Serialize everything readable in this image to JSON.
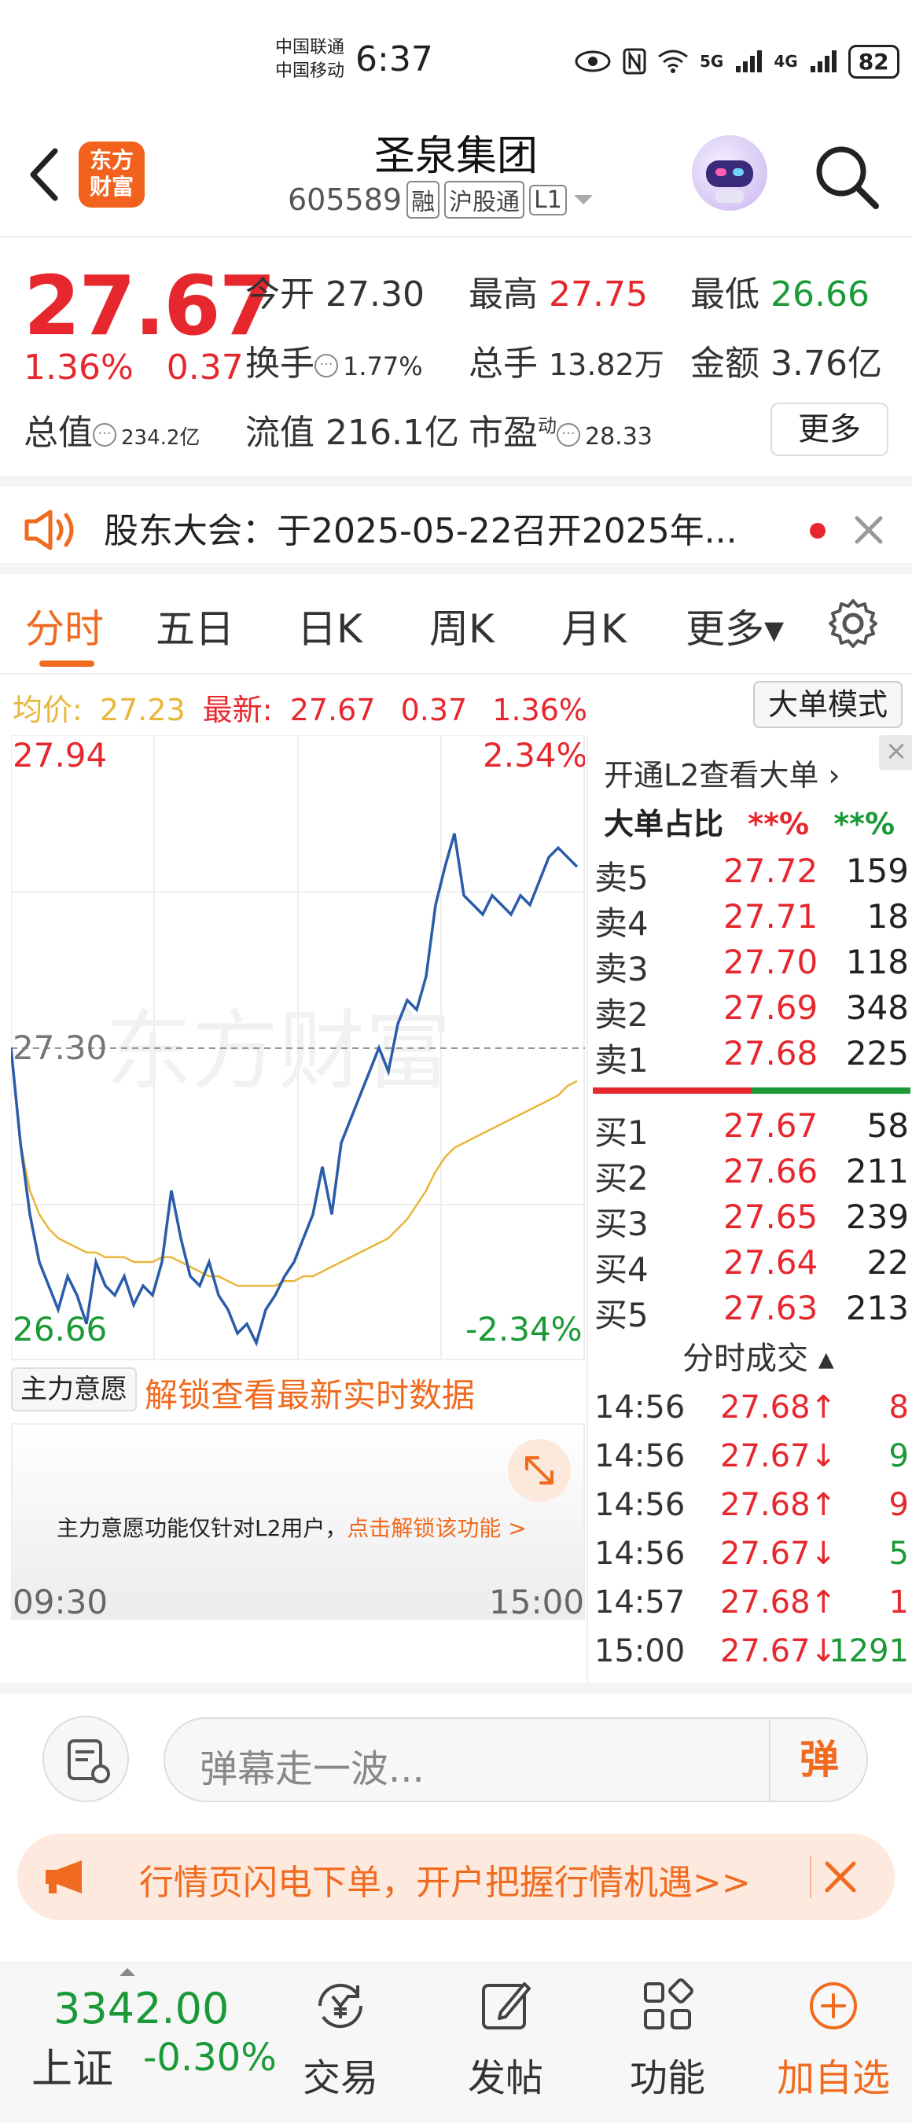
{
  "status_bar": {
    "carrier_1": "中国联通",
    "carrier_2": "中国移动",
    "time": "6:37",
    "network_1": "5G",
    "network_2": "4G",
    "battery": "82"
  },
  "header": {
    "logo_line1": "东方",
    "logo_line2": "财富",
    "stock_name": "圣泉集团",
    "stock_code": "605589",
    "tags": [
      "融",
      "沪股通",
      "L1"
    ]
  },
  "quote": {
    "price": "27.67",
    "change_pct": "1.36%",
    "change_amt": "0.37",
    "open_label": "今开",
    "open": "27.30",
    "high_label": "最高",
    "high": "27.75",
    "low_label": "最低",
    "low": "26.66",
    "turnover_label": "换手",
    "turnover": "1.77%",
    "volume_label": "总手",
    "volume": "13.82万",
    "amount_label": "金额",
    "amount": "3.76亿",
    "mktcap_label": "总值",
    "mktcap": "234.2亿",
    "float_label": "流值",
    "float_cap": "216.1亿",
    "pe_label": "市盈",
    "pe_sup": "动",
    "pe": "28.33",
    "more_button": "更多"
  },
  "notice": {
    "text": "股东大会：于2025-05-22召开2025年..."
  },
  "tabs": [
    {
      "label": "分时",
      "active": true
    },
    {
      "label": "五日"
    },
    {
      "label": "日K"
    },
    {
      "label": "周K"
    },
    {
      "label": "月K"
    },
    {
      "label": "更多▾"
    }
  ],
  "avg_row": {
    "avg_label": "均价:",
    "avg_value": "27.23",
    "latest_label": "最新:",
    "latest_value": "27.67",
    "latest_chg": "0.37",
    "latest_pct": "1.36%",
    "big_order_mode": "大单模式"
  },
  "chart_data": {
    "type": "line",
    "y_max_label": "27.94",
    "y_min_label": "26.66",
    "y_mid_label": "27.30",
    "pct_max_label": "2.34%",
    "pct_min_label": "-2.34%",
    "watermark": "东方财富",
    "x_start_label": "09:30",
    "x_end_label": "15:00",
    "ylim": [
      26.66,
      27.94
    ],
    "prev_close": 27.3,
    "series": [
      {
        "name": "price",
        "color": "#2a5caa",
        "values": [
          27.3,
          27.1,
          26.95,
          26.85,
          26.8,
          26.75,
          26.82,
          26.78,
          26.72,
          26.85,
          26.8,
          26.78,
          26.82,
          26.76,
          26.8,
          26.78,
          26.85,
          27.0,
          26.9,
          26.82,
          26.8,
          26.85,
          26.78,
          26.75,
          26.7,
          26.72,
          26.68,
          26.75,
          26.78,
          26.82,
          26.85,
          26.9,
          26.95,
          27.05,
          26.95,
          27.1,
          27.15,
          27.2,
          27.25,
          27.3,
          27.25,
          27.35,
          27.4,
          27.38,
          27.45,
          27.6,
          27.68,
          27.75,
          27.62,
          27.6,
          27.58,
          27.62,
          27.6,
          27.58,
          27.62,
          27.6,
          27.65,
          27.7,
          27.72,
          27.7,
          27.68
        ]
      },
      {
        "name": "avg",
        "color": "#e8b63a",
        "values": [
          27.3,
          27.1,
          27.0,
          26.95,
          26.92,
          26.9,
          26.89,
          26.88,
          26.87,
          26.87,
          26.86,
          26.86,
          26.86,
          26.85,
          26.85,
          26.85,
          26.86,
          26.86,
          26.85,
          26.84,
          26.83,
          26.82,
          26.82,
          26.81,
          26.8,
          26.8,
          26.8,
          26.8,
          26.8,
          26.81,
          26.81,
          26.82,
          26.82,
          26.83,
          26.84,
          26.85,
          26.86,
          26.87,
          26.88,
          26.89,
          26.9,
          26.92,
          26.94,
          26.97,
          27.0,
          27.04,
          27.07,
          27.09,
          27.1,
          27.11,
          27.12,
          27.13,
          27.14,
          27.15,
          27.16,
          27.17,
          27.18,
          27.19,
          27.2,
          27.22,
          27.23
        ]
      }
    ]
  },
  "orderbook": {
    "l2_link": "开通L2查看大单 ›",
    "big_share_label": "大单占比",
    "big_share_sell": "**%",
    "big_share_buy": "**%",
    "asks": [
      {
        "label": "卖5",
        "price": "27.72",
        "vol": "159"
      },
      {
        "label": "卖4",
        "price": "27.71",
        "vol": "18"
      },
      {
        "label": "卖3",
        "price": "27.70",
        "vol": "118"
      },
      {
        "label": "卖2",
        "price": "27.69",
        "vol": "348"
      },
      {
        "label": "卖1",
        "price": "27.68",
        "vol": "225"
      }
    ],
    "bids": [
      {
        "label": "买1",
        "price": "27.67",
        "vol": "58"
      },
      {
        "label": "买2",
        "price": "27.66",
        "vol": "211"
      },
      {
        "label": "买3",
        "price": "27.65",
        "vol": "239"
      },
      {
        "label": "买4",
        "price": "27.64",
        "vol": "22"
      },
      {
        "label": "买5",
        "price": "27.63",
        "vol": "213"
      }
    ],
    "ticks_title": "分时成交 ▴",
    "ticks": [
      {
        "time": "14:56",
        "price": "27.68↑",
        "vol": "8",
        "dir": "up"
      },
      {
        "time": "14:56",
        "price": "27.67↓",
        "vol": "9",
        "dir": "down"
      },
      {
        "time": "14:56",
        "price": "27.68↑",
        "vol": "9",
        "dir": "up"
      },
      {
        "time": "14:56",
        "price": "27.67↓",
        "vol": "5",
        "dir": "down"
      },
      {
        "time": "14:57",
        "price": "27.68↑",
        "vol": "1",
        "dir": "up"
      },
      {
        "time": "15:00",
        "price": "27.67↓",
        "vol": "1291",
        "dir": "down"
      }
    ]
  },
  "main_force": {
    "dropdown": "主力意愿 ▾",
    "unlock_text": "解锁查看最新实时数据",
    "msg_prefix": "主力意愿功能仅针对L2用户，",
    "msg_link": "点击解锁该功能 >"
  },
  "comment_bar": {
    "placeholder": "弹幕走一波...",
    "danmu_button": "弹"
  },
  "promo": {
    "text": "行情页闪电下单，开户把握行情机遇>>"
  },
  "bottom_nav": {
    "index_value": "3342.00",
    "index_name": "上证",
    "index_pct": "-0.30%",
    "items": [
      {
        "label": "交易",
        "icon": "yen-exchange-icon"
      },
      {
        "label": "发帖",
        "icon": "edit-icon"
      },
      {
        "label": "功能",
        "icon": "grid-icon"
      },
      {
        "label": "加自选",
        "icon": "add-circle-icon"
      }
    ]
  },
  "colors": {
    "up": "#e6282e",
    "down": "#1a9a37",
    "accent": "#f06b1f",
    "price_line": "#2a5caa",
    "avg_line": "#e8b63a"
  }
}
